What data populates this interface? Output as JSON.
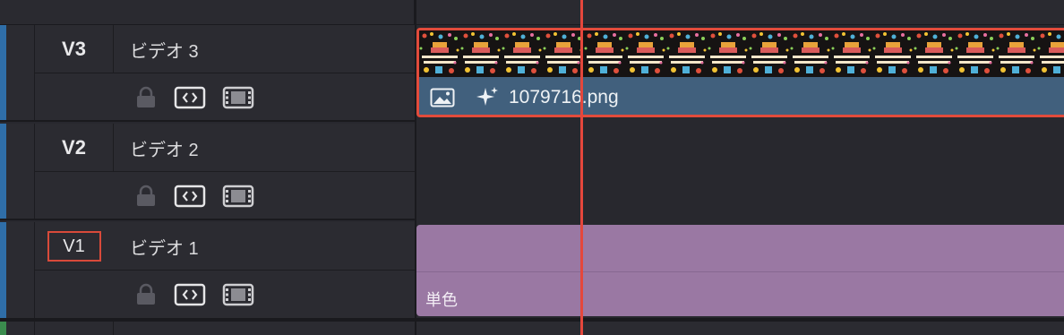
{
  "tracks": [
    {
      "id": "V3",
      "name": "ビデオ 3"
    },
    {
      "id": "V2",
      "name": "ビデオ 2"
    },
    {
      "id": "V1",
      "name": "ビデオ 1"
    }
  ],
  "clips": {
    "v3": {
      "filename": "1079716.png",
      "thumbnail_text": "HAPPY BIRTHDAY"
    },
    "v1": {
      "label": "単色"
    }
  },
  "colors": {
    "playhead": "#e5473c",
    "selected_outline": "#e24b3b",
    "image_clip": "#41607d",
    "solid_clip": "#9a78a3",
    "video_track_accent": "#2f6ea8",
    "audio_track_accent": "#3b8c4e"
  },
  "icons": {
    "lock": "lock-icon",
    "auto_select": "auto-select-icon",
    "track_visibility": "film-strip-icon",
    "image": "image-icon",
    "effects": "sparkle-icon"
  }
}
